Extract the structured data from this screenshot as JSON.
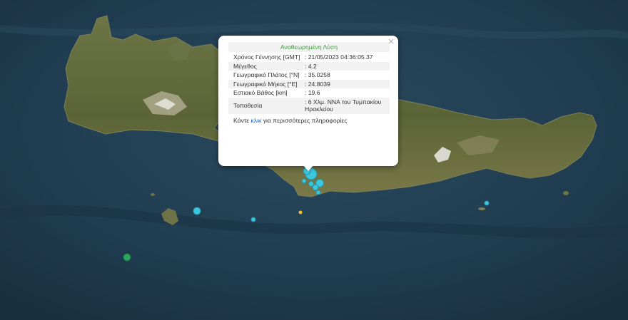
{
  "popup": {
    "title": "Αναθεωρημένη Λύση",
    "close_label": "×",
    "rows": [
      {
        "key": "Χρόνος Γέννησης [GMT]",
        "value": ": 21/05/2023 04:36:05.37"
      },
      {
        "key": "Μέγεθος",
        "value": ": 4.2"
      },
      {
        "key": "Γεωγραφικό Πλάτος [°N]",
        "value": ": 35.0258"
      },
      {
        "key": "Γεωγραφικό Μήκος [°E]",
        "value": ": 24.8039"
      },
      {
        "key": "Εστιακό Βάθος [km]",
        "value": ": 19.6"
      },
      {
        "key": "Τοποθεσία",
        "value": ": 6 Χλμ. ΝΝΑ του Τυμπακίου Ηρακλείου"
      }
    ],
    "more_prefix": "Κάντε ",
    "more_link": "κλικ",
    "more_suffix": " για περισσότερες πληροφορίες"
  },
  "colors": {
    "sea": "#1f3a4e",
    "land": "#5a6a3a",
    "quake_cyan": "#3cc7de",
    "quake_yellow": "#e8c22b",
    "quake_green": "#2aa55a",
    "title_green": "#3aa03a",
    "link_blue": "#1b63b8"
  },
  "icons": {
    "close": "close-icon",
    "marker": "earthquake-marker"
  }
}
